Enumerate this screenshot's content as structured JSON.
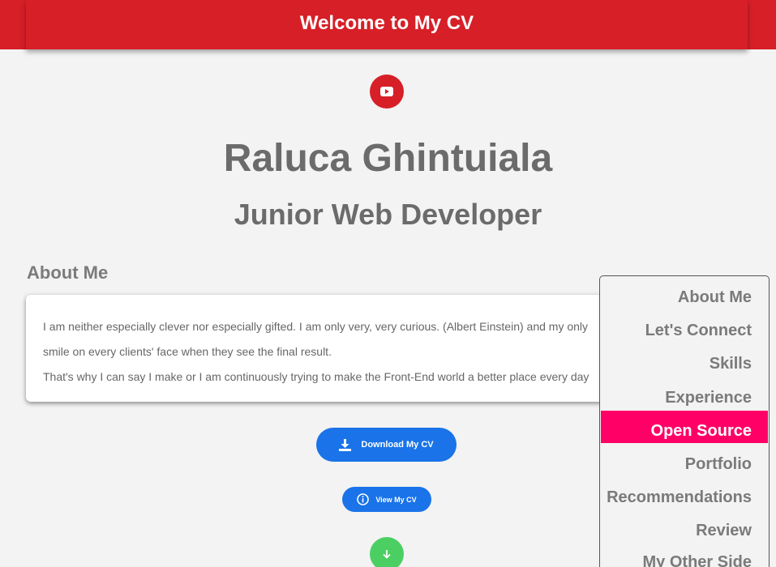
{
  "header": {
    "title": "Welcome to My CV"
  },
  "profile": {
    "name": "Raluca Ghintuiala",
    "role": "Junior Web Developer"
  },
  "about": {
    "title": "About Me",
    "lines": [
      "I am neither especially clever nor especially gifted. I am only very, very curious. (Albert Einstein) and my only",
      "smile on every clients' face when they see the final result.",
      "That's why I can say I make or I am continuously trying to make the Front-End world a better place every day"
    ]
  },
  "buttons": {
    "download_label": "Download My CV",
    "view_label": "View My CV"
  },
  "nav": {
    "items": [
      "About Me",
      "Let's Connect",
      "Skills",
      "Experience",
      "Open Source",
      "Portfolio",
      "Recommendations",
      "Review",
      "My Other Side"
    ],
    "active": "Open Source"
  },
  "colors": {
    "header_bg": "#d71f27",
    "primary_button": "#1a73e8",
    "active_nav": "#ff0066",
    "scroll_button": "#4ccf62"
  },
  "icons": {
    "youtube": "youtube-icon",
    "download": "download-icon",
    "info": "info-icon",
    "scroll_down": "arrow-down-icon"
  }
}
